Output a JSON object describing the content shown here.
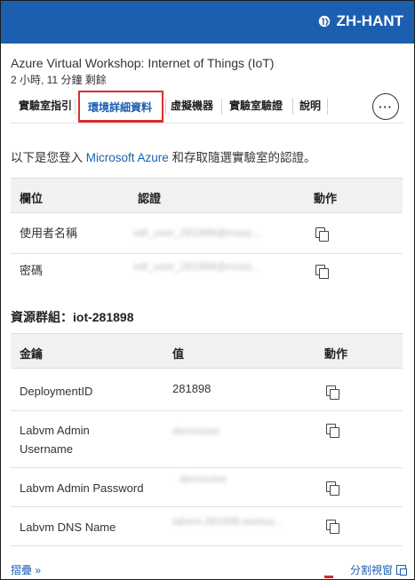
{
  "header": {
    "language": "ZH-HANT"
  },
  "lab": {
    "title": "Azure Virtual Workshop: Internet of Things (IoT)",
    "time_remaining": "2 小時, 11 分鐘 剩餘"
  },
  "tabs": [
    {
      "label": "實驗室指引"
    },
    {
      "label": "環境詳細資料"
    },
    {
      "label": "虛擬機器"
    },
    {
      "label": "實驗室驗證"
    },
    {
      "label": "說明"
    }
  ],
  "more_label": "···",
  "intro": {
    "before": "以下是您登入 ",
    "link": "Microsoft Azure",
    "after": " 和存取隨選實驗室的認證。"
  },
  "credentials": {
    "headers": {
      "field": "欄位",
      "credential": "認證",
      "action": "動作"
    },
    "rows": [
      {
        "field": "使用者名稱",
        "value": "odl_user_281898@msaz..."
      },
      {
        "field": "密碼",
        "value": "odl_user_281898@msaz..."
      }
    ]
  },
  "resource_group": {
    "label": "資源群組：iot-281898"
  },
  "keys": {
    "headers": {
      "key": "金鑰",
      "value": "值",
      "action": "動作"
    },
    "rows": [
      {
        "key": "DeploymentID",
        "value": "281898"
      },
      {
        "key": "Labvm Admin Username",
        "value": "demouser"
      },
      {
        "key": "Labvm Admin Password",
        "value": "demouser"
      },
      {
        "key": "Labvm DNS Name",
        "value": "labvm-281898.eastus..."
      }
    ]
  },
  "footer": {
    "collapse": "摺疊 »",
    "split_view": "分割視窗"
  },
  "colors": {
    "brand": "#1c5fb0",
    "highlight": "#d9302c"
  }
}
